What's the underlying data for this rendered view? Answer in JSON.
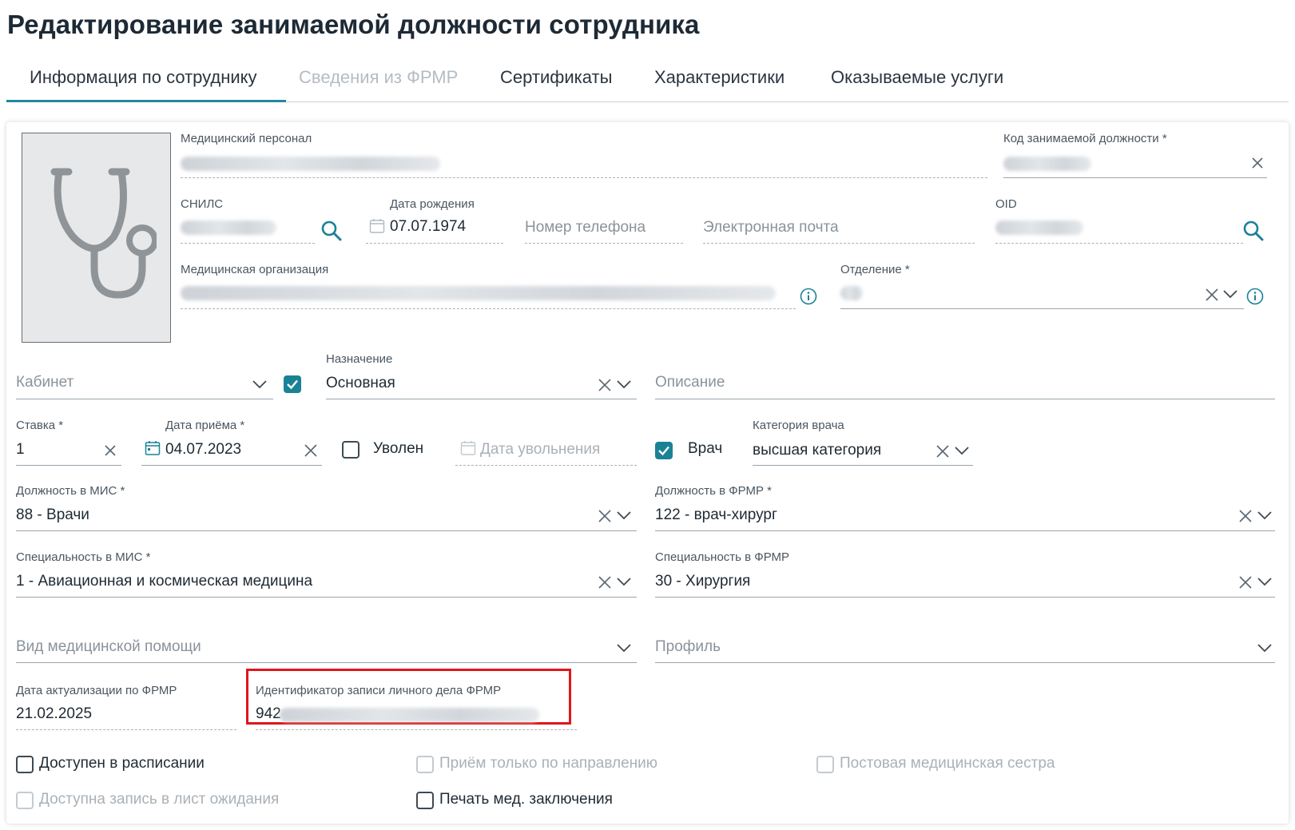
{
  "title": "Редактирование занимаемой должности сотрудника",
  "tabs": [
    {
      "label": "Информация по сотруднику",
      "state": "active"
    },
    {
      "label": "Сведения из ФРМР",
      "state": "disabled"
    },
    {
      "label": "Сертификаты",
      "state": "normal"
    },
    {
      "label": "Характеристики",
      "state": "normal"
    },
    {
      "label": "Оказываемые услуги",
      "state": "normal"
    }
  ],
  "form": {
    "medical_staff_label": "Медицинский персонал",
    "position_code_label": "Код занимаемой должности *",
    "snils_label": "СНИЛС",
    "birth_date_label": "Дата рождения",
    "birth_date_value": "07.07.1974",
    "phone_placeholder": "Номер телефона",
    "email_placeholder": "Электронная почта",
    "oid_label": "OID",
    "med_org_label": "Медицинская организация",
    "department_label": "Отделение *",
    "cabinet_placeholder": "Кабинет",
    "assignment_label": "Назначение",
    "assignment_value": "Основная",
    "description_placeholder": "Описание",
    "rate_label": "Ставка *",
    "rate_value": "1",
    "hire_date_label": "Дата приёма *",
    "hire_date_value": "04.07.2023",
    "dismissed_label": "Уволен",
    "dismissal_date_placeholder": "Дата увольнения",
    "doctor_label": "Врач",
    "doctor_category_label": "Категория врача",
    "doctor_category_value": "высшая категория",
    "mis_position_label": "Должность в МИС *",
    "mis_position_value": "88 - Врачи",
    "frmr_position_label": "Должность в ФРМР *",
    "frmr_position_value": "122 - врач-хирург",
    "mis_specialty_label": "Специальность в МИС *",
    "mis_specialty_value": "1 - Авиационная и космическая медицина",
    "frmr_specialty_label": "Специальность в ФРМР",
    "frmr_specialty_value": "30 - Хирургия",
    "care_type_placeholder": "Вид медицинской помощи",
    "profile_placeholder": "Профиль",
    "frmr_update_date_label": "Дата актуализации по ФРМР",
    "frmr_update_date_value": "21.02.2025",
    "frmr_record_id_label": "Идентификатор записи личного дела ФРМР",
    "frmr_record_id_prefix": "942"
  },
  "checkboxes": [
    {
      "label": "Доступен в расписании",
      "checked": false,
      "disabled": false
    },
    {
      "label": "Приём только по направлению",
      "checked": false,
      "disabled": true
    },
    {
      "label": "Постовая медицинская сестра",
      "checked": false,
      "disabled": true
    },
    {
      "label": "Доступна запись в лист ожидания",
      "checked": false,
      "disabled": true
    },
    {
      "label": "Печать мед. заключения",
      "checked": false,
      "disabled": false
    }
  ],
  "toggles": {
    "cabinet_checkbox_checked": true,
    "dismissed_checked": false,
    "doctor_checked": true
  },
  "colors": {
    "accent": "#1b8296",
    "tab_active_underline": "#20889f",
    "highlight_frame": "#e0161b"
  }
}
